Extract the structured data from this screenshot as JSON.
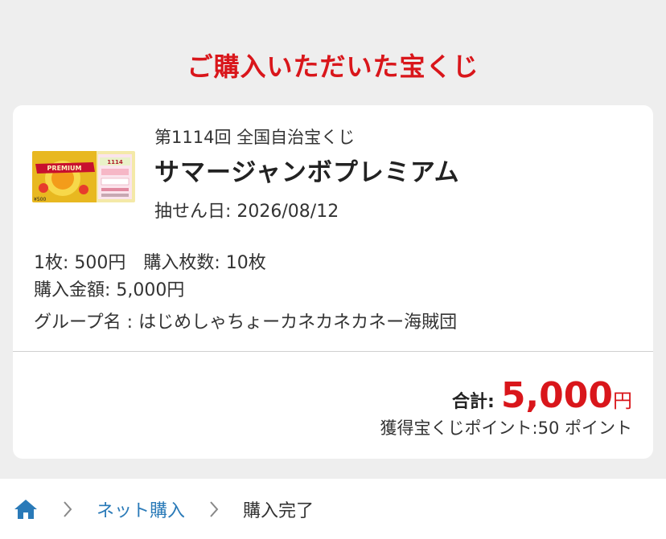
{
  "page": {
    "title": "ご購入いただいた宝くじ"
  },
  "ticket": {
    "round": "第1114回 全国自治宝くじ",
    "name": "サマージャンボプレミアム",
    "draw_date": "抽せん日: 2026/08/12",
    "unit_price": "1枚: 500円",
    "quantity": "購入枚数: 10枚",
    "amount": "購入金額: 5,000円",
    "group": "グループ名 : はじめしゃちょーカネカネカネー海賊団",
    "image_text": {
      "banner": "PREMIUM",
      "round_no": "1114",
      "price": "¥500"
    }
  },
  "summary": {
    "total_label": "合計:",
    "total_value": "5,000",
    "total_unit": "円",
    "points": "獲得宝くじポイント:50 ポイント"
  },
  "breadcrumb": {
    "home_icon": "home-icon",
    "items": [
      "ネット購入",
      "購入完了"
    ]
  },
  "colors": {
    "accent_red": "#d9161b",
    "link_blue": "#2a7ab8",
    "background": "#eeeeee"
  }
}
